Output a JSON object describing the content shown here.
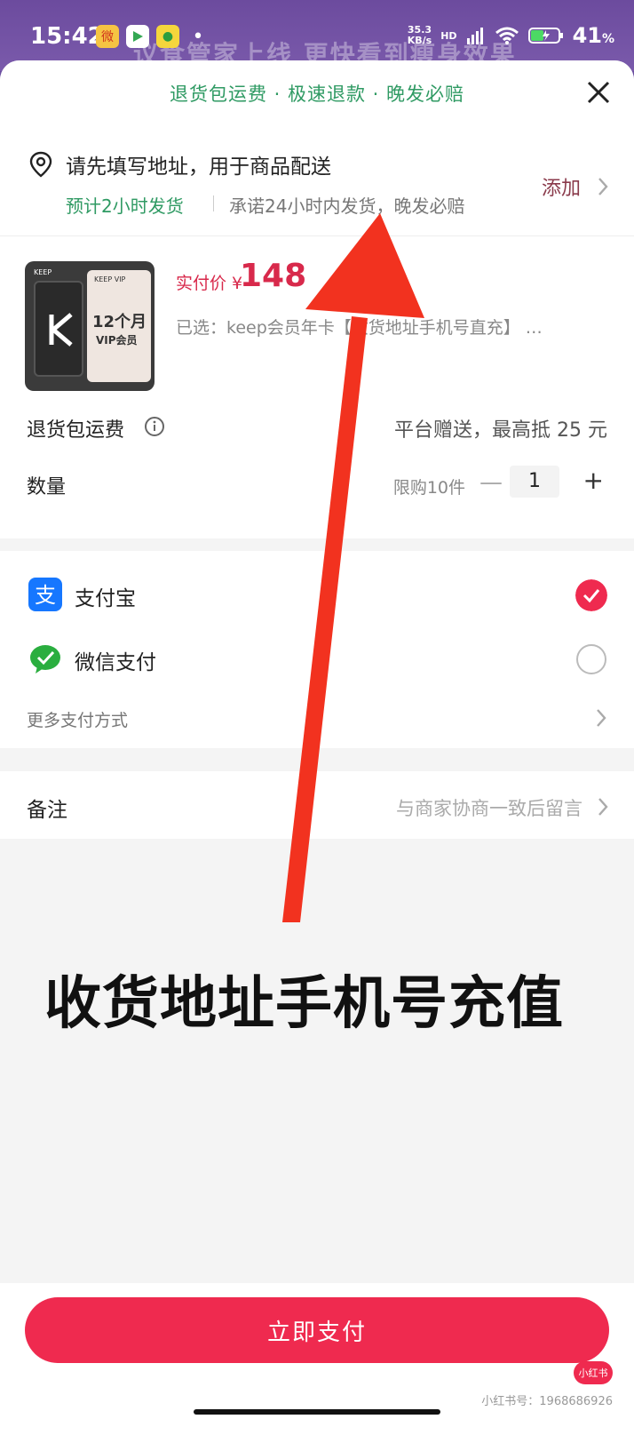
{
  "status": {
    "time": "15:42",
    "net_speed_value": "35.3",
    "net_speed_unit": "KB/s",
    "network": "HD",
    "battery": "41",
    "battery_unit": "%"
  },
  "background_text": "议食管家上线 更快看到瘦身效果",
  "banner": {
    "text": "退货包运费 · 极速退款 · 晚发必赔"
  },
  "address": {
    "title": "请先填写地址，用于商品配送",
    "eta": "预计2小时发货",
    "promise": "承诺24小时内发货，晚发必赔",
    "add_label": "添加"
  },
  "product": {
    "thumb_brand": "KEEP",
    "thumb_vip": "KEEP VIP",
    "thumb_months": "12个月",
    "thumb_member": "VIP会员",
    "price_label": "实付价 ¥",
    "price_value": "148",
    "selected": "已选：keep会员年卡【收货地址手机号直充】 …"
  },
  "shipping_insurance": {
    "label": "退货包运费",
    "value": "平台赠送，最高抵 25 元"
  },
  "quantity": {
    "label": "数量",
    "limit": "限购10件",
    "minus": "—",
    "value": "1",
    "plus": "+"
  },
  "payment": {
    "alipay_label": "支付宝",
    "wechat_label": "微信支付",
    "more_label": "更多支付方式",
    "selected": "alipay"
  },
  "remark": {
    "label": "备注",
    "hint": "与商家协商一致后留言"
  },
  "overlay_caption": "收货地址手机号充值",
  "pay_button": "立即支付",
  "watermark": {
    "logo": "小红书",
    "id": "小红书号：1968686926"
  },
  "colors": {
    "accent_red": "#ef2a4f",
    "green": "#2f9a63",
    "alipay_blue": "#1677ff",
    "wechat_green": "#2aae3f",
    "arrow_red": "#f2321f"
  }
}
